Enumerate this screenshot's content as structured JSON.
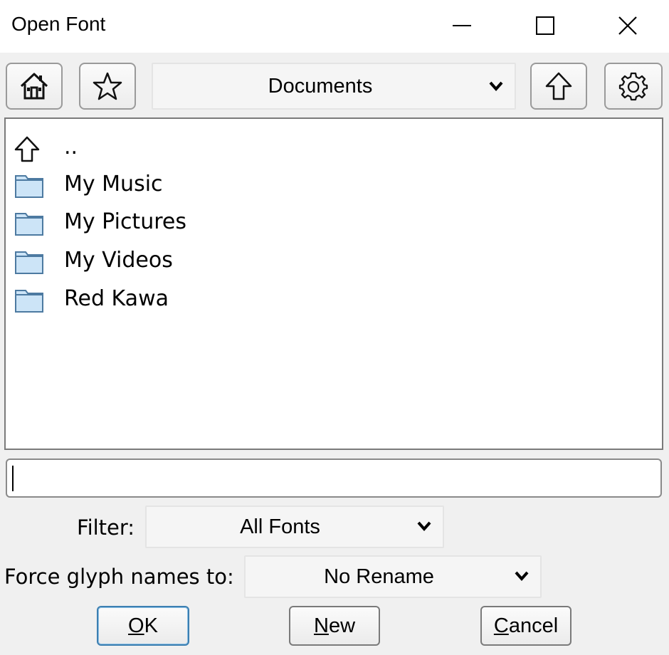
{
  "window": {
    "title": "Open Font"
  },
  "toolbar": {
    "home_icon": "home-icon",
    "bookmark_icon": "star-icon",
    "current_dir": "Documents",
    "up_icon": "up-arrow-icon",
    "settings_icon": "gear-icon"
  },
  "files": [
    {
      "name": "..",
      "icon": "up-arrow-icon"
    },
    {
      "name": "My Music",
      "icon": "folder-icon"
    },
    {
      "name": "My Pictures",
      "icon": "folder-icon"
    },
    {
      "name": "My Videos",
      "icon": "folder-icon"
    },
    {
      "name": "Red Kawa",
      "icon": "folder-icon"
    }
  ],
  "filename": {
    "value": "",
    "placeholder": ""
  },
  "filter": {
    "label": "Filter:",
    "value": "All Fonts"
  },
  "rename": {
    "label": "Force glyph names to:",
    "value": "No Rename"
  },
  "buttons": {
    "ok": {
      "mnemonic": "O",
      "rest": "K"
    },
    "new": {
      "mnemonic": "N",
      "rest": "ew"
    },
    "cancel": {
      "mnemonic": "C",
      "rest": "ancel"
    }
  },
  "colors": {
    "folder_fill": "#cce4f7",
    "folder_stroke": "#4d7aa1",
    "default_button": "#3c7fb1"
  }
}
